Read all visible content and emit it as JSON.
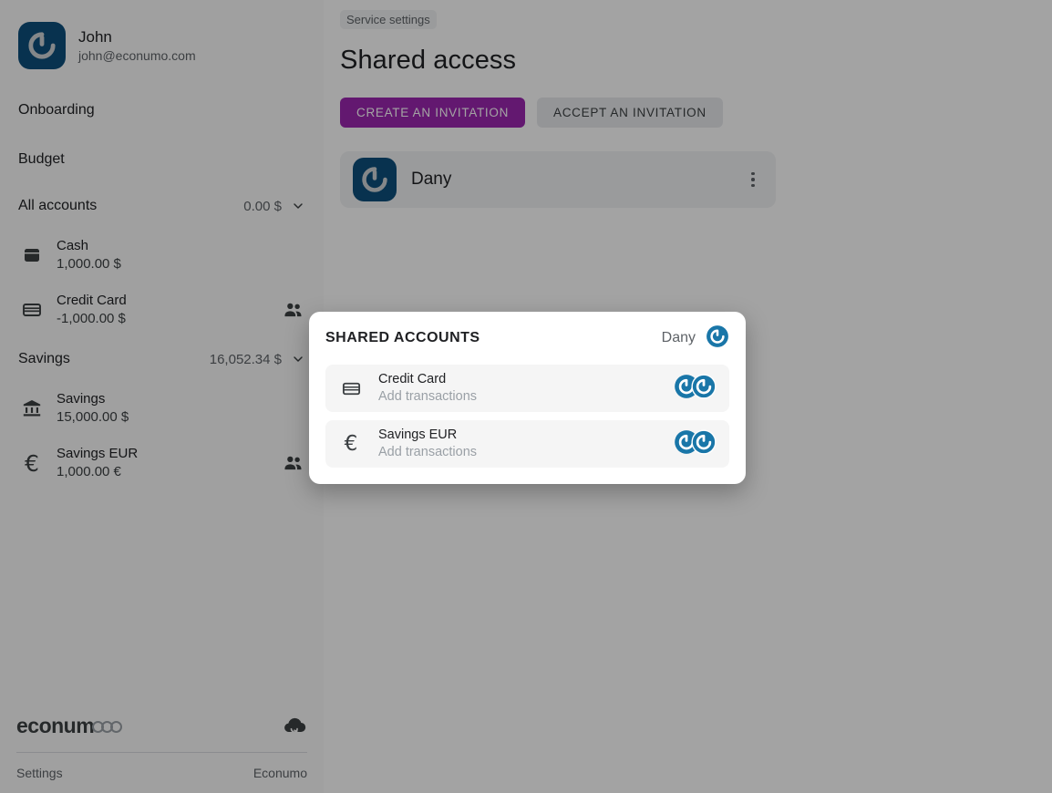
{
  "colors": {
    "brand_blue": "#1976a8",
    "avatar_square_bg": "#0d4f7c",
    "primary_button": "#9c27b0",
    "secondary_button": "#e8eaed",
    "overlay": "rgba(0,0,0,0.36)",
    "dialog_row_bg": "#f5f5f5",
    "text_primary": "#202124",
    "text_secondary": "#5f6368",
    "text_muted": "#9aa0a6"
  },
  "sidebar": {
    "profile": {
      "name": "John",
      "email": "john@econumo.com",
      "avatar_icon": "econumo-logo-avatar"
    },
    "nav": [
      {
        "label": "Onboarding",
        "name": "sidebar-nav-onboarding"
      },
      {
        "label": "Budget",
        "name": "sidebar-nav-budget"
      }
    ],
    "groups": [
      {
        "title": "All accounts",
        "amount": "0.00 $",
        "accounts": [
          {
            "name": "Cash",
            "balance": "1,000.00 $",
            "icon": "wallet-icon",
            "shared": false
          },
          {
            "name": "Credit Card",
            "balance": "-1,000.00 $",
            "icon": "credit-card-icon",
            "shared": true
          }
        ]
      },
      {
        "title": "Savings",
        "amount": "16,052.34 $",
        "accounts": [
          {
            "name": "Savings",
            "balance": "15,000.00 $",
            "icon": "bank-icon",
            "shared": false
          },
          {
            "name": "Savings EUR",
            "balance": "1,000.00 €",
            "icon": "euro-icon",
            "shared": true
          }
        ]
      }
    ],
    "footer": {
      "brand_word": "econum",
      "brand_dots": 3,
      "sync_icon": "cloud-sync-icon",
      "links": [
        {
          "label": "Settings",
          "name": "footer-link-settings"
        },
        {
          "label": "Econumo",
          "name": "footer-link-econumo"
        }
      ]
    }
  },
  "main": {
    "breadcrumb": "Service settings",
    "title": "Shared access",
    "buttons": {
      "primary": "CREATE AN INVITATION",
      "secondary": "ACCEPT AN INVITATION"
    },
    "people": [
      {
        "name": "Dany",
        "avatar_icon": "econumo-logo-avatar",
        "menu_icon": "more-vertical-icon"
      }
    ]
  },
  "dialog": {
    "title": "SHARED ACCOUNTS",
    "owner": "Dany",
    "owner_avatar_icon": "econumo-logo-avatar",
    "rows": [
      {
        "name": "Credit Card",
        "subtitle": "Add transactions",
        "icon": "credit-card-icon",
        "avatars": 2
      },
      {
        "name": "Savings EUR",
        "subtitle": "Add transactions",
        "icon": "euro-icon",
        "avatars": 2
      }
    ]
  }
}
